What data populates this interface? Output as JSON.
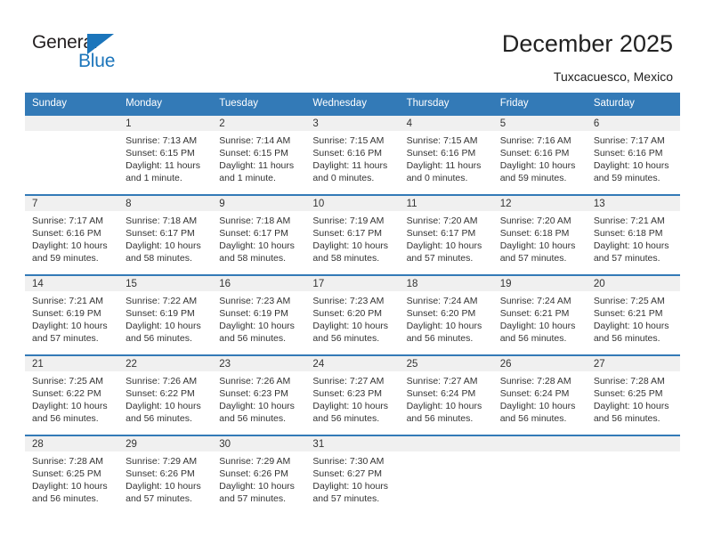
{
  "brand": {
    "name_top": "General",
    "name_bottom": "Blue",
    "triangle_color": "#1b75bb",
    "text_color": "#231f20"
  },
  "header": {
    "title": "December 2025",
    "subtitle": "Tuxcacuesco, Mexico"
  },
  "calendar": {
    "header_color": "#337ab7",
    "daynum_band_color": "#f0f0f0",
    "weekdays": [
      "Sunday",
      "Monday",
      "Tuesday",
      "Wednesday",
      "Thursday",
      "Friday",
      "Saturday"
    ],
    "weeks": [
      [
        {
          "day": "",
          "sunrise": "",
          "sunset": "",
          "daylight_1": "",
          "daylight_2": ""
        },
        {
          "day": "1",
          "sunrise": "Sunrise: 7:13 AM",
          "sunset": "Sunset: 6:15 PM",
          "daylight_1": "Daylight: 11 hours",
          "daylight_2": "and 1 minute."
        },
        {
          "day": "2",
          "sunrise": "Sunrise: 7:14 AM",
          "sunset": "Sunset: 6:15 PM",
          "daylight_1": "Daylight: 11 hours",
          "daylight_2": "and 1 minute."
        },
        {
          "day": "3",
          "sunrise": "Sunrise: 7:15 AM",
          "sunset": "Sunset: 6:16 PM",
          "daylight_1": "Daylight: 11 hours",
          "daylight_2": "and 0 minutes."
        },
        {
          "day": "4",
          "sunrise": "Sunrise: 7:15 AM",
          "sunset": "Sunset: 6:16 PM",
          "daylight_1": "Daylight: 11 hours",
          "daylight_2": "and 0 minutes."
        },
        {
          "day": "5",
          "sunrise": "Sunrise: 7:16 AM",
          "sunset": "Sunset: 6:16 PM",
          "daylight_1": "Daylight: 10 hours",
          "daylight_2": "and 59 minutes."
        },
        {
          "day": "6",
          "sunrise": "Sunrise: 7:17 AM",
          "sunset": "Sunset: 6:16 PM",
          "daylight_1": "Daylight: 10 hours",
          "daylight_2": "and 59 minutes."
        }
      ],
      [
        {
          "day": "7",
          "sunrise": "Sunrise: 7:17 AM",
          "sunset": "Sunset: 6:16 PM",
          "daylight_1": "Daylight: 10 hours",
          "daylight_2": "and 59 minutes."
        },
        {
          "day": "8",
          "sunrise": "Sunrise: 7:18 AM",
          "sunset": "Sunset: 6:17 PM",
          "daylight_1": "Daylight: 10 hours",
          "daylight_2": "and 58 minutes."
        },
        {
          "day": "9",
          "sunrise": "Sunrise: 7:18 AM",
          "sunset": "Sunset: 6:17 PM",
          "daylight_1": "Daylight: 10 hours",
          "daylight_2": "and 58 minutes."
        },
        {
          "day": "10",
          "sunrise": "Sunrise: 7:19 AM",
          "sunset": "Sunset: 6:17 PM",
          "daylight_1": "Daylight: 10 hours",
          "daylight_2": "and 58 minutes."
        },
        {
          "day": "11",
          "sunrise": "Sunrise: 7:20 AM",
          "sunset": "Sunset: 6:17 PM",
          "daylight_1": "Daylight: 10 hours",
          "daylight_2": "and 57 minutes."
        },
        {
          "day": "12",
          "sunrise": "Sunrise: 7:20 AM",
          "sunset": "Sunset: 6:18 PM",
          "daylight_1": "Daylight: 10 hours",
          "daylight_2": "and 57 minutes."
        },
        {
          "day": "13",
          "sunrise": "Sunrise: 7:21 AM",
          "sunset": "Sunset: 6:18 PM",
          "daylight_1": "Daylight: 10 hours",
          "daylight_2": "and 57 minutes."
        }
      ],
      [
        {
          "day": "14",
          "sunrise": "Sunrise: 7:21 AM",
          "sunset": "Sunset: 6:19 PM",
          "daylight_1": "Daylight: 10 hours",
          "daylight_2": "and 57 minutes."
        },
        {
          "day": "15",
          "sunrise": "Sunrise: 7:22 AM",
          "sunset": "Sunset: 6:19 PM",
          "daylight_1": "Daylight: 10 hours",
          "daylight_2": "and 56 minutes."
        },
        {
          "day": "16",
          "sunrise": "Sunrise: 7:23 AM",
          "sunset": "Sunset: 6:19 PM",
          "daylight_1": "Daylight: 10 hours",
          "daylight_2": "and 56 minutes."
        },
        {
          "day": "17",
          "sunrise": "Sunrise: 7:23 AM",
          "sunset": "Sunset: 6:20 PM",
          "daylight_1": "Daylight: 10 hours",
          "daylight_2": "and 56 minutes."
        },
        {
          "day": "18",
          "sunrise": "Sunrise: 7:24 AM",
          "sunset": "Sunset: 6:20 PM",
          "daylight_1": "Daylight: 10 hours",
          "daylight_2": "and 56 minutes."
        },
        {
          "day": "19",
          "sunrise": "Sunrise: 7:24 AM",
          "sunset": "Sunset: 6:21 PM",
          "daylight_1": "Daylight: 10 hours",
          "daylight_2": "and 56 minutes."
        },
        {
          "day": "20",
          "sunrise": "Sunrise: 7:25 AM",
          "sunset": "Sunset: 6:21 PM",
          "daylight_1": "Daylight: 10 hours",
          "daylight_2": "and 56 minutes."
        }
      ],
      [
        {
          "day": "21",
          "sunrise": "Sunrise: 7:25 AM",
          "sunset": "Sunset: 6:22 PM",
          "daylight_1": "Daylight: 10 hours",
          "daylight_2": "and 56 minutes."
        },
        {
          "day": "22",
          "sunrise": "Sunrise: 7:26 AM",
          "sunset": "Sunset: 6:22 PM",
          "daylight_1": "Daylight: 10 hours",
          "daylight_2": "and 56 minutes."
        },
        {
          "day": "23",
          "sunrise": "Sunrise: 7:26 AM",
          "sunset": "Sunset: 6:23 PM",
          "daylight_1": "Daylight: 10 hours",
          "daylight_2": "and 56 minutes."
        },
        {
          "day": "24",
          "sunrise": "Sunrise: 7:27 AM",
          "sunset": "Sunset: 6:23 PM",
          "daylight_1": "Daylight: 10 hours",
          "daylight_2": "and 56 minutes."
        },
        {
          "day": "25",
          "sunrise": "Sunrise: 7:27 AM",
          "sunset": "Sunset: 6:24 PM",
          "daylight_1": "Daylight: 10 hours",
          "daylight_2": "and 56 minutes."
        },
        {
          "day": "26",
          "sunrise": "Sunrise: 7:28 AM",
          "sunset": "Sunset: 6:24 PM",
          "daylight_1": "Daylight: 10 hours",
          "daylight_2": "and 56 minutes."
        },
        {
          "day": "27",
          "sunrise": "Sunrise: 7:28 AM",
          "sunset": "Sunset: 6:25 PM",
          "daylight_1": "Daylight: 10 hours",
          "daylight_2": "and 56 minutes."
        }
      ],
      [
        {
          "day": "28",
          "sunrise": "Sunrise: 7:28 AM",
          "sunset": "Sunset: 6:25 PM",
          "daylight_1": "Daylight: 10 hours",
          "daylight_2": "and 56 minutes."
        },
        {
          "day": "29",
          "sunrise": "Sunrise: 7:29 AM",
          "sunset": "Sunset: 6:26 PM",
          "daylight_1": "Daylight: 10 hours",
          "daylight_2": "and 57 minutes."
        },
        {
          "day": "30",
          "sunrise": "Sunrise: 7:29 AM",
          "sunset": "Sunset: 6:26 PM",
          "daylight_1": "Daylight: 10 hours",
          "daylight_2": "and 57 minutes."
        },
        {
          "day": "31",
          "sunrise": "Sunrise: 7:30 AM",
          "sunset": "Sunset: 6:27 PM",
          "daylight_1": "Daylight: 10 hours",
          "daylight_2": "and 57 minutes."
        },
        {
          "day": "",
          "sunrise": "",
          "sunset": "",
          "daylight_1": "",
          "daylight_2": ""
        },
        {
          "day": "",
          "sunrise": "",
          "sunset": "",
          "daylight_1": "",
          "daylight_2": ""
        },
        {
          "day": "",
          "sunrise": "",
          "sunset": "",
          "daylight_1": "",
          "daylight_2": ""
        }
      ]
    ]
  }
}
